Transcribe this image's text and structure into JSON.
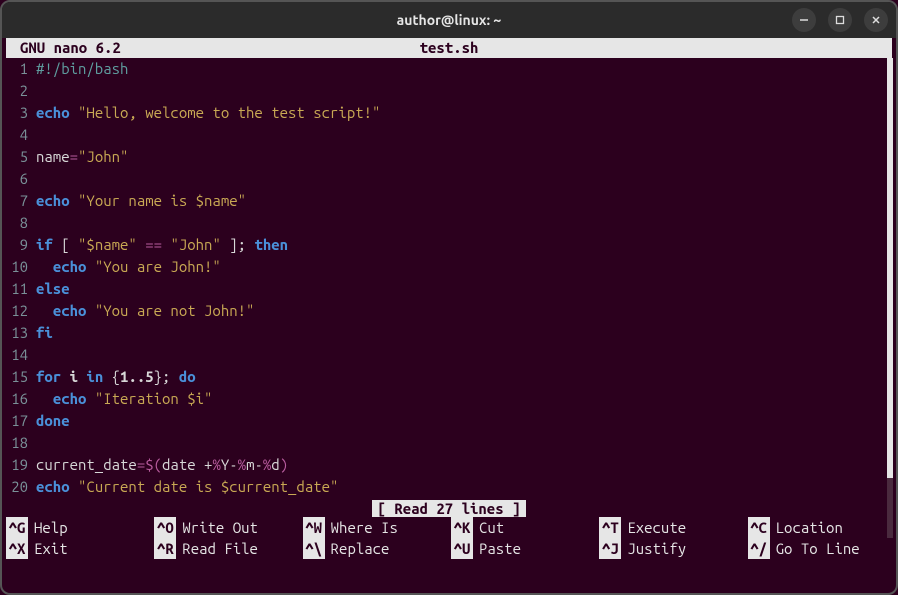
{
  "window": {
    "title": "author@linux: ~"
  },
  "nano": {
    "app": "GNU nano 6.2",
    "filename": "test.sh",
    "status": "[ Read 27 lines ]"
  },
  "code": [
    {
      "n": "1",
      "tokens": [
        [
          "comment",
          "#!/bin/bash"
        ]
      ]
    },
    {
      "n": "2",
      "tokens": []
    },
    {
      "n": "3",
      "tokens": [
        [
          "builtin",
          "echo"
        ],
        [
          "plain",
          " "
        ],
        [
          "string",
          "\"Hello, welcome to the test script!\""
        ]
      ]
    },
    {
      "n": "4",
      "tokens": []
    },
    {
      "n": "5",
      "tokens": [
        [
          "plain",
          "name"
        ],
        [
          "op",
          "="
        ],
        [
          "string",
          "\"John\""
        ]
      ]
    },
    {
      "n": "6",
      "tokens": []
    },
    {
      "n": "7",
      "tokens": [
        [
          "builtin",
          "echo"
        ],
        [
          "plain",
          " "
        ],
        [
          "string",
          "\"Your name is $name\""
        ]
      ]
    },
    {
      "n": "8",
      "tokens": []
    },
    {
      "n": "9",
      "tokens": [
        [
          "keyword",
          "if"
        ],
        [
          "plain",
          " [ "
        ],
        [
          "string",
          "\"$name\""
        ],
        [
          "plain",
          " "
        ],
        [
          "op",
          "=="
        ],
        [
          "plain",
          " "
        ],
        [
          "string",
          "\"John\""
        ],
        [
          "plain",
          " ]; "
        ],
        [
          "keyword",
          "then"
        ]
      ]
    },
    {
      "n": "10",
      "tokens": [
        [
          "plain",
          "  "
        ],
        [
          "builtin",
          "echo"
        ],
        [
          "plain",
          " "
        ],
        [
          "string",
          "\"You are John!\""
        ]
      ]
    },
    {
      "n": "11",
      "tokens": [
        [
          "keyword",
          "else"
        ]
      ]
    },
    {
      "n": "12",
      "tokens": [
        [
          "plain",
          "  "
        ],
        [
          "builtin",
          "echo"
        ],
        [
          "plain",
          " "
        ],
        [
          "string",
          "\"You are not John!\""
        ]
      ]
    },
    {
      "n": "13",
      "tokens": [
        [
          "keyword",
          "fi"
        ]
      ]
    },
    {
      "n": "14",
      "tokens": []
    },
    {
      "n": "15",
      "tokens": [
        [
          "keyword",
          "for"
        ],
        [
          "plain",
          " "
        ],
        [
          "num",
          "i"
        ],
        [
          "plain",
          " "
        ],
        [
          "keyword",
          "in"
        ],
        [
          "plain",
          " {"
        ],
        [
          "num",
          "1..5"
        ],
        [
          "plain",
          "}; "
        ],
        [
          "keyword",
          "do"
        ]
      ]
    },
    {
      "n": "16",
      "tokens": [
        [
          "plain",
          "  "
        ],
        [
          "builtin",
          "echo"
        ],
        [
          "plain",
          " "
        ],
        [
          "string",
          "\"Iteration $i\""
        ]
      ]
    },
    {
      "n": "17",
      "tokens": [
        [
          "keyword",
          "done"
        ]
      ]
    },
    {
      "n": "18",
      "tokens": []
    },
    {
      "n": "19",
      "tokens": [
        [
          "plain",
          "current_date"
        ],
        [
          "op",
          "="
        ],
        [
          "op",
          "$("
        ],
        [
          "plain",
          "date +"
        ],
        [
          "op",
          "%"
        ],
        [
          "plain",
          "Y-"
        ],
        [
          "op",
          "%"
        ],
        [
          "plain",
          "m-"
        ],
        [
          "op",
          "%"
        ],
        [
          "plain",
          "d"
        ],
        [
          "op",
          ")"
        ]
      ]
    },
    {
      "n": "20",
      "tokens": [
        [
          "builtin",
          "echo"
        ],
        [
          "plain",
          " "
        ],
        [
          "string",
          "\"Current date is $current_date\""
        ]
      ]
    }
  ],
  "shortcuts": [
    {
      "key": "^G",
      "label": "Help"
    },
    {
      "key": "^O",
      "label": "Write Out"
    },
    {
      "key": "^W",
      "label": "Where Is"
    },
    {
      "key": "^K",
      "label": "Cut"
    },
    {
      "key": "^T",
      "label": "Execute"
    },
    {
      "key": "^C",
      "label": "Location"
    },
    {
      "key": "^X",
      "label": "Exit"
    },
    {
      "key": "^R",
      "label": "Read File"
    },
    {
      "key": "^\\",
      "label": "Replace"
    },
    {
      "key": "^U",
      "label": "Paste"
    },
    {
      "key": "^J",
      "label": "Justify"
    },
    {
      "key": "^/",
      "label": "Go To Line"
    }
  ]
}
